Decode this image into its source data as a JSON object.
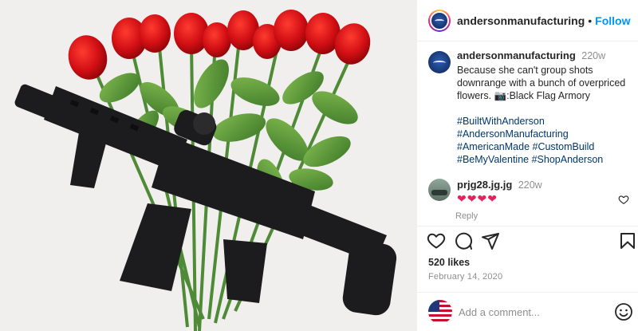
{
  "post": {
    "username": "andersonmanufacturing",
    "follow_label": "Follow",
    "separator": "•",
    "caption": {
      "username": "andersonmanufacturing",
      "time": "220w",
      "text": "Because she can't group shots downrange with a bunch of overpriced flowers. 📷:Black Flag Armory",
      "hashtags": [
        "#BuiltWithAnderson",
        "#AndersonManufacturing",
        "#AmericanMade",
        "#CustomBuild",
        "#BeMyValentine",
        "#ShopAnderson"
      ]
    },
    "comment": {
      "username": "prjg28.jg.jg",
      "time": "220w",
      "text": "❤❤❤❤",
      "reply_label": "Reply"
    },
    "likes": "520 likes",
    "date": "February 14, 2020",
    "add_comment_placeholder": "Add a comment..."
  },
  "icons": {
    "like": "heart-icon",
    "comment": "comment-icon",
    "share": "send-icon",
    "save": "bookmark-icon",
    "emoji": "smiley-icon",
    "comment_like": "small-heart-icon"
  },
  "colors": {
    "link": "#0095f6",
    "hashtag": "#00376b",
    "muted": "#8e8e8e",
    "heart": "#e0245e"
  }
}
